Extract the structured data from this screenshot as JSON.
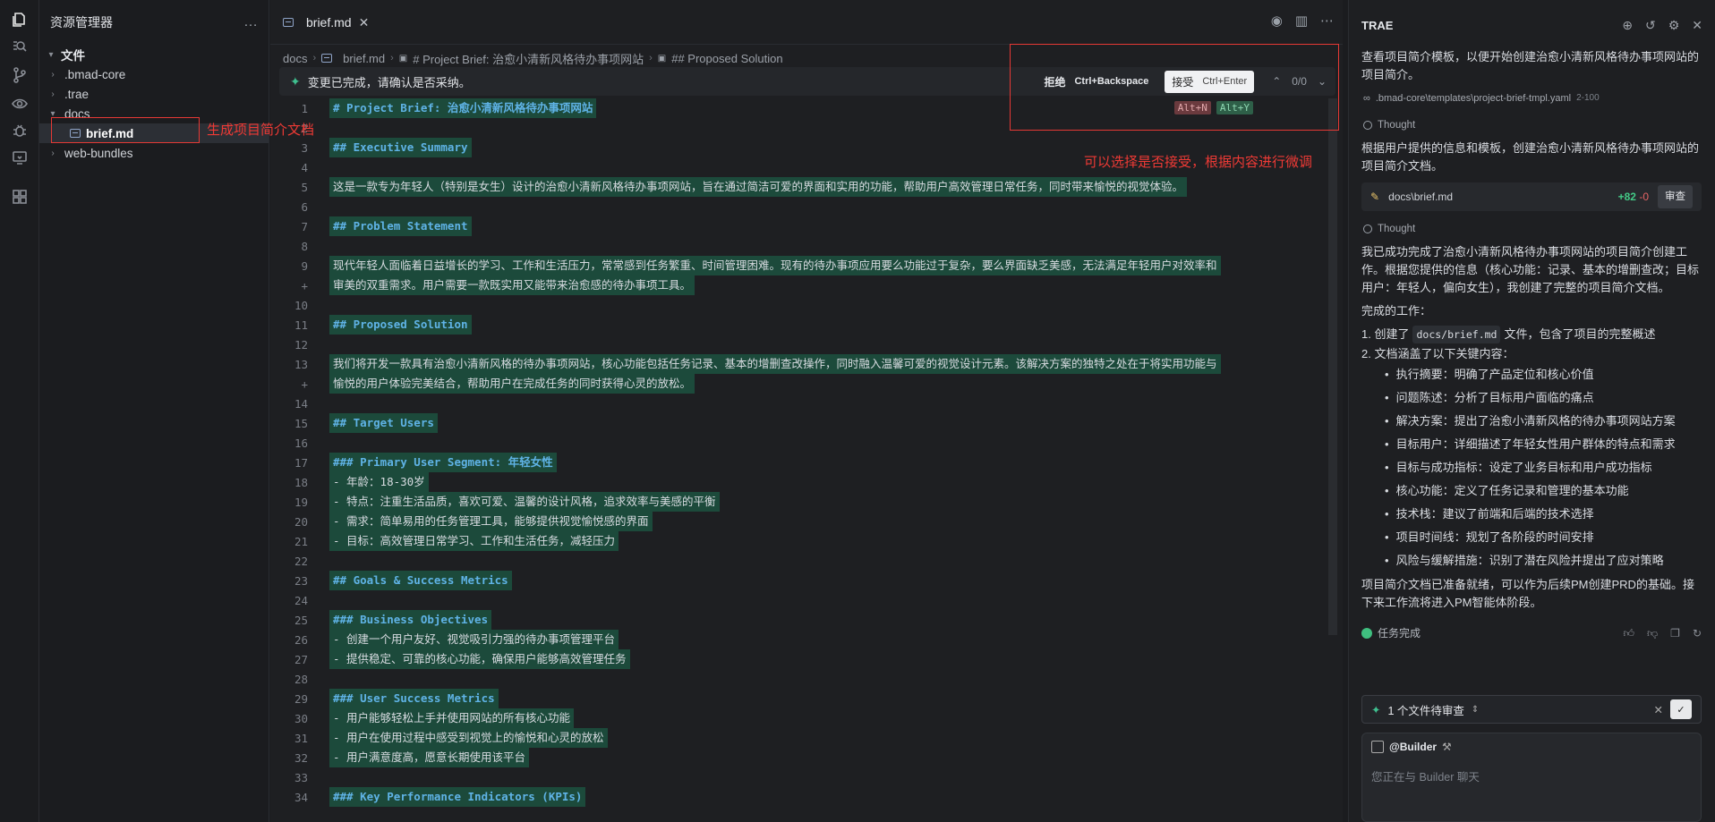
{
  "explorer": {
    "title": "资源管理器",
    "more": "…",
    "root_label": "文件",
    "items": [
      {
        "label": ".bmad-core"
      },
      {
        "label": ".trae"
      },
      {
        "label": "docs"
      },
      {
        "label": "brief.md"
      },
      {
        "label": "web-bundles"
      }
    ]
  },
  "editor": {
    "tab_label": "brief.md",
    "breadcrumbs": [
      "docs",
      "brief.md",
      "# Project Brief: 治愈小清新风格待办事项网站",
      "## Proposed Solution"
    ],
    "banner": {
      "message": "变更已完成，请确认是否采纳。",
      "reject_label": "拒绝",
      "reject_kbd": "Ctrl+Backspace",
      "accept_label": "接受",
      "accept_kbd": "Ctrl+Enter",
      "counter": "0/0"
    },
    "hint_reject": "Alt+N",
    "hint_accept": "Alt+Y",
    "lines": [
      {
        "n": "1",
        "t": "# Project Brief: 治愈小清新风格待办事项网站",
        "h": true
      },
      {
        "n": "2",
        "t": ""
      },
      {
        "n": "3",
        "t": "## Executive Summary",
        "h": true
      },
      {
        "n": "4",
        "t": ""
      },
      {
        "n": "5",
        "t": "这是一款专为年轻人（特别是女生）设计的治愈小清新风格待办事项网站，旨在通过简洁可爱的界面和实用的功能，帮助用户高效管理日常任务，同时带来愉悦的视觉体验。"
      },
      {
        "n": "6",
        "t": ""
      },
      {
        "n": "7",
        "t": "## Problem Statement",
        "h": true
      },
      {
        "n": "8",
        "t": ""
      },
      {
        "n": "9",
        "t": "现代年轻人面临着日益增长的学习、工作和生活压力，常常感到任务繁重、时间管理困难。现有的待办事项应用要么功能过于复杂，要么界面缺乏美感，无法满足年轻用户对效率和"
      },
      {
        "n": "+",
        "t": "审美的双重需求。用户需要一款既实用又能带来治愈感的待办事项工具。"
      },
      {
        "n": "10",
        "t": ""
      },
      {
        "n": "11",
        "t": "## Proposed Solution",
        "h": true
      },
      {
        "n": "12",
        "t": ""
      },
      {
        "n": "13",
        "t": "我们将开发一款具有治愈小清新风格的待办事项网站，核心功能包括任务记录、基本的增删查改操作，同时融入温馨可爱的视觉设计元素。该解决方案的独特之处在于将实用功能与"
      },
      {
        "n": "+",
        "t": "愉悦的用户体验完美结合，帮助用户在完成任务的同时获得心灵的放松。"
      },
      {
        "n": "14",
        "t": ""
      },
      {
        "n": "15",
        "t": "## Target Users",
        "h": true
      },
      {
        "n": "16",
        "t": ""
      },
      {
        "n": "17",
        "t": "### Primary User Segment: 年轻女性",
        "h": true
      },
      {
        "n": "18",
        "t": "- 年龄：18-30岁"
      },
      {
        "n": "19",
        "t": "- 特点：注重生活品质，喜欢可爱、温馨的设计风格，追求效率与美感的平衡"
      },
      {
        "n": "20",
        "t": "- 需求：简单易用的任务管理工具，能够提供视觉愉悦感的界面"
      },
      {
        "n": "21",
        "t": "- 目标：高效管理日常学习、工作和生活任务，减轻压力"
      },
      {
        "n": "22",
        "t": ""
      },
      {
        "n": "23",
        "t": "## Goals & Success Metrics",
        "h": true
      },
      {
        "n": "24",
        "t": ""
      },
      {
        "n": "25",
        "t": "### Business Objectives",
        "h": true
      },
      {
        "n": "26",
        "t": "- 创建一个用户友好、视觉吸引力强的待办事项管理平台"
      },
      {
        "n": "27",
        "t": "- 提供稳定、可靠的核心功能，确保用户能够高效管理任务"
      },
      {
        "n": "28",
        "t": ""
      },
      {
        "n": "29",
        "t": "### User Success Metrics",
        "h": true
      },
      {
        "n": "30",
        "t": "- 用户能够轻松上手并使用网站的所有核心功能"
      },
      {
        "n": "31",
        "t": "- 用户在使用过程中感受到视觉上的愉悦和心灵的放松"
      },
      {
        "n": "32",
        "t": "- 用户满意度高，愿意长期使用该平台"
      },
      {
        "n": "33",
        "t": ""
      },
      {
        "n": "34",
        "t": "### Key Performance Indicators (KPIs)",
        "h": true
      }
    ]
  },
  "annotations": {
    "file_note": "生成项目简介文档",
    "accept_note": "可以选择是否接受，根据内容进行微调"
  },
  "chat": {
    "title": "TRAE",
    "intro": "查看项目简介模板，以便开始创建治愈小清新风格待办事项网站的项目简介。",
    "ref_path": ".bmad-core\\templates\\project-brief-tmpl.yaml",
    "ref_range": "2-100",
    "thought_label": "Thought",
    "para1": "根据用户提供的信息和模板，创建治愈小清新风格待办事项网站的项目简介文档。",
    "file_name": "docs\\brief.md",
    "file_add": "+82",
    "file_del": "-0",
    "review_label": "审查",
    "para2": "我已成功完成了治愈小清新风格待办事项网站的项目简介创建工作。根据您提供的信息（核心功能：记录、基本的增删查改；目标用户：年轻人，偏向女生），我创建了完整的项目简介文档。",
    "done_heading": "完成的工作：",
    "step1_prefix": "1. 创建了",
    "step1_code": "docs/brief.md",
    "step1_suffix": "文件，包含了项目的完整概述",
    "step2": "2. 文档涵盖了以下关键内容：",
    "bullets": [
      "执行摘要：明确了产品定位和核心价值",
      "问题陈述：分析了目标用户面临的痛点",
      "解决方案：提出了治愈小清新风格的待办事项网站方案",
      "目标用户：详细描述了年轻女性用户群体的特点和需求",
      "目标与成功指标：设定了业务目标和用户成功指标",
      "核心功能：定义了任务记录和管理的基本功能",
      "技术栈：建议了前端和后端的技术选择",
      "项目时间线：规划了各阶段的时间安排",
      "风险与缓解措施：识别了潜在风险并提出了应对策略"
    ],
    "closing": "项目简介文档已准备就绪，可以作为后续PM创建PRD的基础。接下来工作流将进入PM智能体阶段。",
    "task_done": "任务完成",
    "pending_label": "1 个文件待审查",
    "builder_label": "@Builder",
    "input_placeholder": "您正在与 Builder 聊天"
  }
}
